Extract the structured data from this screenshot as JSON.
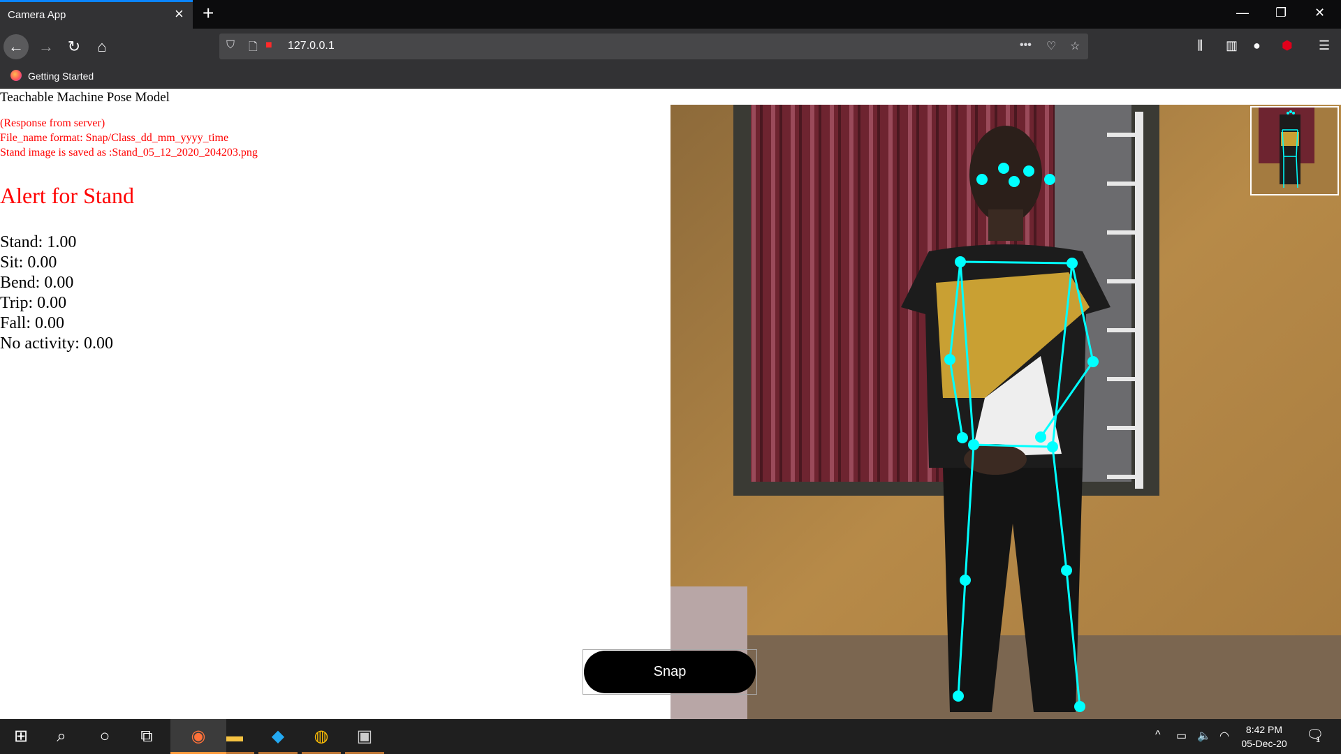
{
  "browser": {
    "tab_title": "Camera App",
    "url": "127.0.0.1",
    "bookmark_label": "Getting Started"
  },
  "page": {
    "title": "Teachable Machine Pose Model",
    "response_lines": [
      "(Response from server)",
      "File_name format: Snap/Class_dd_mm_yyyy_time",
      "Stand image is saved as :Stand_05_12_2020_204203.png"
    ],
    "alert": "Alert for Stand",
    "scores": [
      "Stand: 1.00",
      "Sit: 0.00",
      "Bend: 0.00",
      "Trip: 0.00",
      "Fall: 0.00",
      "No activity: 0.00"
    ],
    "snap_label": "Snap"
  },
  "taskbar": {
    "time": "8:42 PM",
    "date": "05-Dec-20",
    "notification_count": "1"
  },
  "colors": {
    "alert": "#ff0000",
    "skeleton": "#00ffff",
    "accent": "#0a84ff"
  }
}
